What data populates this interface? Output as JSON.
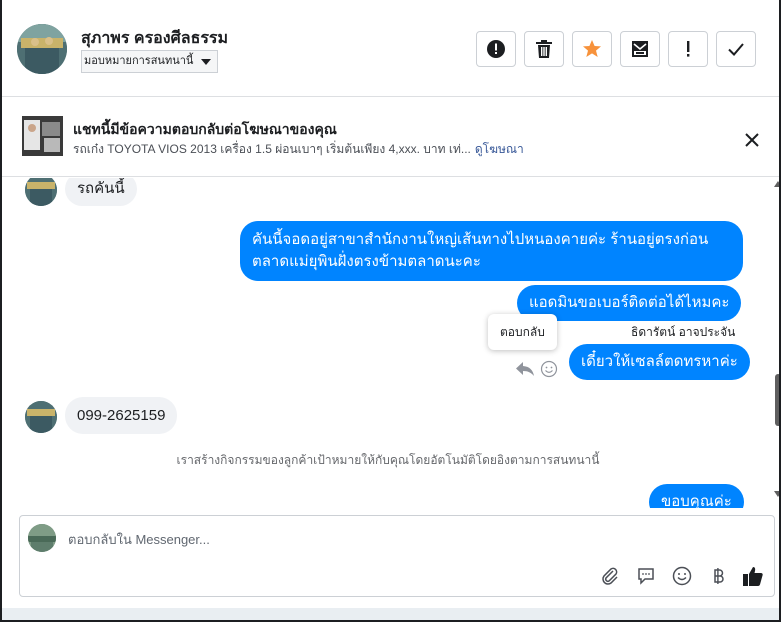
{
  "header": {
    "contact_name": "สุภาพร ครองศีลธรรม",
    "assign_label": "มอบหมายการสนทนานี้",
    "actions": [
      {
        "name": "alert-circle-icon"
      },
      {
        "name": "trash-icon"
      },
      {
        "name": "star-icon",
        "color": "#f7923b"
      },
      {
        "name": "archive-icon"
      },
      {
        "name": "exclamation-icon"
      },
      {
        "name": "check-icon"
      }
    ]
  },
  "ad_banner": {
    "title": "แชทนี้มีข้อความตอบกลับต่อโฆษณาของคุณ",
    "subtitle": "รถเก๋ง TOYOTA VIOS 2013 เครื่อง 1.5 ผ่อนเบาๆ เริ่มต้นเพียง 4,xxx. บาท เท่...",
    "link": "ดูโฆษณา"
  },
  "conversation": {
    "messages": [
      {
        "dir": "in",
        "text": "รถคันนี้"
      },
      {
        "dir": "out",
        "lines": [
          "คันนี้จอดอยู่สาขาสำนักงานใหญ่เส้นทางไปหนองคายค่ะ ร้านอยู่ตรงก่อน",
          "ตลาดแม่ยุพินฝั่งตรงข้ามตลาดนะคะ"
        ]
      },
      {
        "dir": "out",
        "text": "แอดมินขอเบอร์ติดต่อได้ไหมคะ"
      },
      {
        "dir": "out",
        "text": "เดี๋ยวให้เซลล์ตดทรหาค่ะ",
        "sender": "ธิดารัตน์ อาจประจัน"
      },
      {
        "dir": "in",
        "text": "099-2625159"
      },
      {
        "dir": "out",
        "text": "ขอบคุณค่ะ"
      }
    ],
    "tooltip": "ตอบกลับ",
    "system_note": "เราสร้างกิจกรรมของลูกค้าเป้าหมายให้กับคุณโดยอัตโนมัติโดยอิงตามการสนทนานี้"
  },
  "composer": {
    "placeholder": "ตอบกลับใน Messenger...",
    "icons": [
      "attachment-icon",
      "saved-replies-icon",
      "emoji-icon",
      "payment-icon",
      "like-icon"
    ],
    "accent": "#0084ff"
  }
}
